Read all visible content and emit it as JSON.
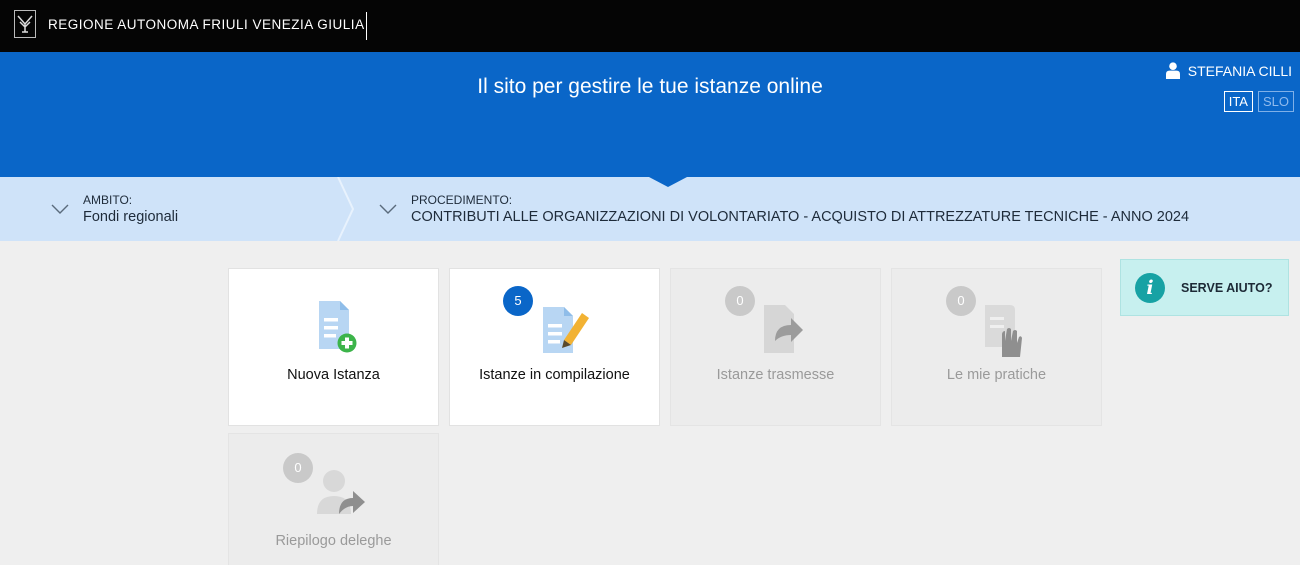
{
  "topbar": {
    "title": "REGIONE AUTONOMA FRIULI VENEZIA GIULIA"
  },
  "header": {
    "headline": "Il sito per gestire le tue istanze online",
    "user_name": "STEFANIA CILLI",
    "languages": [
      {
        "code": "ITA",
        "active": true
      },
      {
        "code": "SLO",
        "active": false
      }
    ]
  },
  "breadcrumb": {
    "ambito": {
      "label": "AMBITO:",
      "value": "Fondi regionali"
    },
    "procedimento": {
      "label": "PROCEDIMENTO:",
      "value": "CONTRIBUTI ALLE ORGANIZZAZIONI DI VOLONTARIATO - ACQUISTO DI ATTREZZATURE TECNICHE - ANNO 2024"
    }
  },
  "tiles": [
    {
      "label": "Nuova Istanza",
      "badge": null,
      "enabled": true,
      "icon": "new-document-icon"
    },
    {
      "label": "Istanze in compilazione",
      "badge": "5",
      "enabled": true,
      "icon": "edit-document-icon"
    },
    {
      "label": "Istanze trasmesse",
      "badge": "0",
      "enabled": false,
      "icon": "send-document-icon"
    },
    {
      "label": "Le mie pratiche",
      "badge": "0",
      "enabled": false,
      "icon": "hand-document-icon"
    },
    {
      "label": "Riepilogo deleghe",
      "badge": "0",
      "enabled": false,
      "icon": "delegate-user-icon"
    }
  ],
  "help": {
    "label": "SERVE AIUTO?",
    "icon": "info-icon"
  },
  "colors": {
    "header_blue": "#0a66c8",
    "crumb_bg": "#cfe3f9",
    "help_bg": "#c7f0ef",
    "help_icon": "#17a2a4"
  }
}
